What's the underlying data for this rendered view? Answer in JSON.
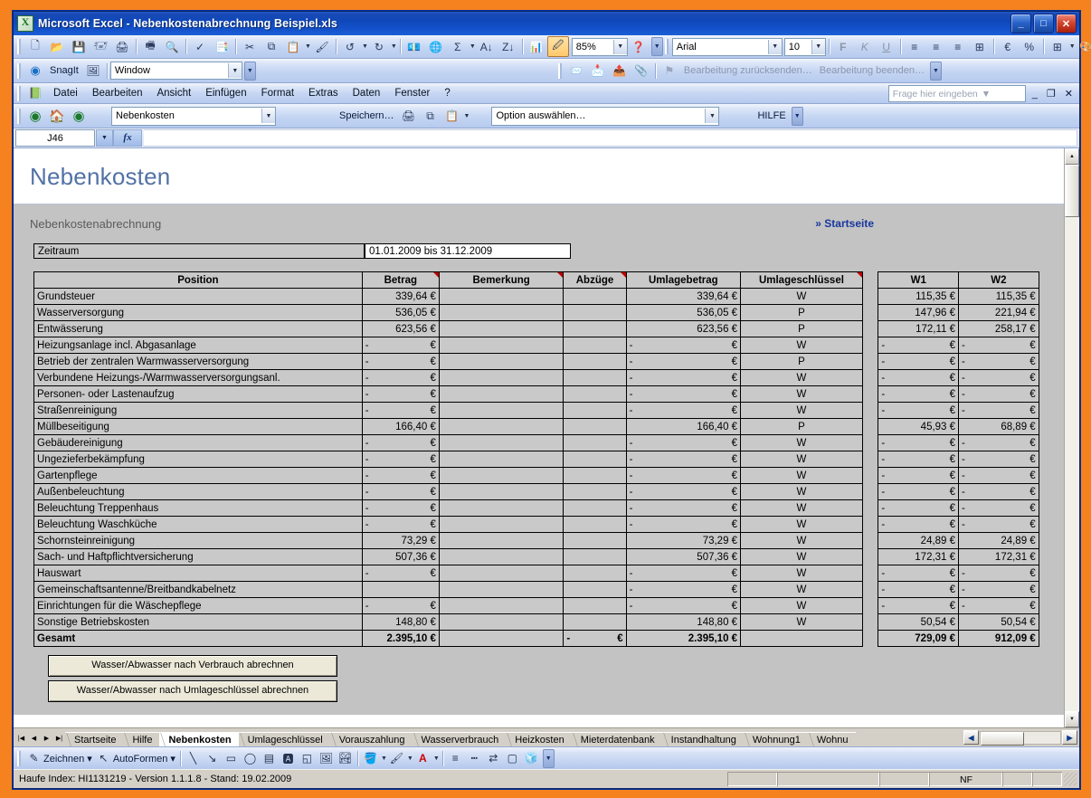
{
  "window": {
    "title": "Microsoft Excel - Nebenkostenabrechnung Beispiel.xls",
    "minimize": "_",
    "maximize": "□",
    "close": "✕"
  },
  "standard_toolbar": {
    "zoom": "85%",
    "font_name": "Arial",
    "font_size": "10",
    "bold": "F",
    "italic": "K",
    "underline": "U",
    "euro": "€"
  },
  "snagit_toolbar": {
    "label": "SnagIt",
    "profile": "Window",
    "send_for_review": "Bearbeitung zurücksenden…",
    "end_review": "Bearbeitung beenden…"
  },
  "menubar": {
    "items": [
      "Datei",
      "Bearbeiten",
      "Ansicht",
      "Einfügen",
      "Format",
      "Extras",
      "Daten",
      "Fenster",
      "?"
    ],
    "ask_placeholder": "Frage hier eingeben",
    "restore": "❐",
    "close": "✕",
    "minimize": "_"
  },
  "nav_toolbar": {
    "sheet_selector": "Nebenkosten",
    "save_label": "Speichern…",
    "option_selector": "Option auswählen…",
    "help_label": "HILFE"
  },
  "formula_bar": {
    "name_box": "J46",
    "fx": "fx",
    "content": ""
  },
  "page": {
    "title": "Nebenkosten",
    "subtitle": "Nebenkostenabrechnung",
    "start_link": "» Startseite",
    "period_label": "Zeitraum",
    "period_value": "01.01.2009 bis 31.12.2009"
  },
  "table": {
    "headers": [
      "Position",
      "Betrag",
      "Bemerkung",
      "Abzüge",
      "Umlagebetrag",
      "Umlageschlüssel",
      "W1",
      "W2"
    ],
    "rows": [
      {
        "position": "Grundsteuer",
        "betrag": "339,64 €",
        "bemerkung": "",
        "abzuege": "",
        "umlagebetrag": "339,64 €",
        "schluessel": "W",
        "w1": "115,35 €",
        "w2": "115,35 €"
      },
      {
        "position": "Wasserversorgung",
        "betrag": "536,05 €",
        "bemerkung": "",
        "abzuege": "",
        "umlagebetrag": "536,05 €",
        "schluessel": "P",
        "w1": "147,96 €",
        "w2": "221,94 €"
      },
      {
        "position": "Entwässerung",
        "betrag": "623,56 €",
        "bemerkung": "",
        "abzuege": "",
        "umlagebetrag": "623,56 €",
        "schluessel": "P",
        "w1": "172,11 €",
        "w2": "258,17 €"
      },
      {
        "position": "Heizungsanlage incl. Abgasanlage",
        "betrag": "-   €",
        "bemerkung": "",
        "abzuege": "",
        "umlagebetrag": "-   €",
        "schluessel": "W",
        "w1": "-   €",
        "w2": "-   €"
      },
      {
        "position": "Betrieb der zentralen Warmwasserversorgung",
        "betrag": "-   €",
        "bemerkung": "",
        "abzuege": "",
        "umlagebetrag": "-   €",
        "schluessel": "P",
        "w1": "-   €",
        "w2": "-   €"
      },
      {
        "position": "Verbundene Heizungs-/Warmwasserversorgungsanl.",
        "betrag": "-   €",
        "bemerkung": "",
        "abzuege": "",
        "umlagebetrag": "-   €",
        "schluessel": "W",
        "w1": "-   €",
        "w2": "-   €"
      },
      {
        "position": "Personen- oder Lastenaufzug",
        "betrag": "-   €",
        "bemerkung": "",
        "abzuege": "",
        "umlagebetrag": "-   €",
        "schluessel": "W",
        "w1": "-   €",
        "w2": "-   €"
      },
      {
        "position": "Straßenreinigung",
        "betrag": "-   €",
        "bemerkung": "",
        "abzuege": "",
        "umlagebetrag": "-   €",
        "schluessel": "W",
        "w1": "-   €",
        "w2": "-   €"
      },
      {
        "position": "Müllbeseitigung",
        "betrag": "166,40 €",
        "bemerkung": "",
        "abzuege": "",
        "umlagebetrag": "166,40 €",
        "schluessel": "P",
        "w1": "45,93 €",
        "w2": "68,89 €"
      },
      {
        "position": "Gebäudereinigung",
        "betrag": "-   €",
        "bemerkung": "",
        "abzuege": "",
        "umlagebetrag": "-   €",
        "schluessel": "W",
        "w1": "-   €",
        "w2": "-   €"
      },
      {
        "position": "Ungezieferbekämpfung",
        "betrag": "-   €",
        "bemerkung": "",
        "abzuege": "",
        "umlagebetrag": "-   €",
        "schluessel": "W",
        "w1": "-   €",
        "w2": "-   €"
      },
      {
        "position": "Gartenpflege",
        "betrag": "-   €",
        "bemerkung": "",
        "abzuege": "",
        "umlagebetrag": "-   €",
        "schluessel": "W",
        "w1": "-   €",
        "w2": "-   €"
      },
      {
        "position": "Außenbeleuchtung",
        "betrag": "-   €",
        "bemerkung": "",
        "abzuege": "",
        "umlagebetrag": "-   €",
        "schluessel": "W",
        "w1": "-   €",
        "w2": "-   €"
      },
      {
        "position": "Beleuchtung Treppenhaus",
        "betrag": "-   €",
        "bemerkung": "",
        "abzuege": "",
        "umlagebetrag": "-   €",
        "schluessel": "W",
        "w1": "-   €",
        "w2": "-   €"
      },
      {
        "position": "Beleuchtung Waschküche",
        "betrag": "-   €",
        "bemerkung": "",
        "abzuege": "",
        "umlagebetrag": "-   €",
        "schluessel": "W",
        "w1": "-   €",
        "w2": "-   €"
      },
      {
        "position": "Schornsteinreinigung",
        "betrag": "73,29 €",
        "bemerkung": "",
        "abzuege": "",
        "umlagebetrag": "73,29 €",
        "schluessel": "W",
        "w1": "24,89 €",
        "w2": "24,89 €"
      },
      {
        "position": "Sach- und Haftpflichtversicherung",
        "betrag": "507,36 €",
        "bemerkung": "",
        "abzuege": "",
        "umlagebetrag": "507,36 €",
        "schluessel": "W",
        "w1": "172,31 €",
        "w2": "172,31 €"
      },
      {
        "position": "Hauswart",
        "betrag": "-   €",
        "bemerkung": "",
        "abzuege": "",
        "umlagebetrag": "-   €",
        "schluessel": "W",
        "w1": "-   €",
        "w2": "-   €"
      },
      {
        "position": "Gemeinschaftsantenne/Breitbandkabelnetz",
        "betrag": "",
        "bemerkung": "",
        "abzuege": "",
        "umlagebetrag": "-   €",
        "schluessel": "W",
        "w1": "-   €",
        "w2": "-   €"
      },
      {
        "position": "Einrichtungen für die Wäschepflege",
        "betrag": "-   €",
        "bemerkung": "",
        "abzuege": "",
        "umlagebetrag": "-   €",
        "schluessel": "W",
        "w1": "-   €",
        "w2": "-   €"
      },
      {
        "position": "Sonstige Betriebskosten",
        "betrag": "148,80 €",
        "bemerkung": "",
        "abzuege": "",
        "umlagebetrag": "148,80 €",
        "schluessel": "W",
        "w1": "50,54 €",
        "w2": "50,54 €"
      }
    ],
    "total": {
      "position": "Gesamt",
      "betrag": "2.395,10 €",
      "bemerkung": "",
      "abzuege": "-   €",
      "umlagebetrag": "2.395,10 €",
      "schluessel": "",
      "w1": "729,09 €",
      "w2": "912,09 €"
    }
  },
  "action_buttons": [
    "Wasser/Abwasser nach Verbrauch abrechnen",
    "Wasser/Abwasser nach Umlageschlüssel abrechnen"
  ],
  "sheet_tabs": {
    "items": [
      "Startseite",
      "Hilfe",
      "Nebenkosten",
      "Umlageschlüssel",
      "Vorauszahlung",
      "Wasserverbrauch",
      "Heizkosten",
      "Mieterdatenbank",
      "Instandhaltung",
      "Wohnung1",
      "Wohnu"
    ],
    "active": "Nebenkosten"
  },
  "drawing_toolbar": {
    "draw_label": "Zeichnen ▾",
    "autoshapes_label": "AutoFormen ▾"
  },
  "status_bar": {
    "left": "Haufe Index: HI1131219 - Version 1.1.1.8 - Stand: 19.02.2009",
    "nf": "NF"
  },
  "colors": {
    "title_blue": "#0f47ba",
    "accent_link": "#17379e",
    "page_title": "#5272a6",
    "band_gray": "#c3c3c3",
    "cell_gray": "#c9c9c9",
    "desktop_orange": "#f5821f"
  }
}
